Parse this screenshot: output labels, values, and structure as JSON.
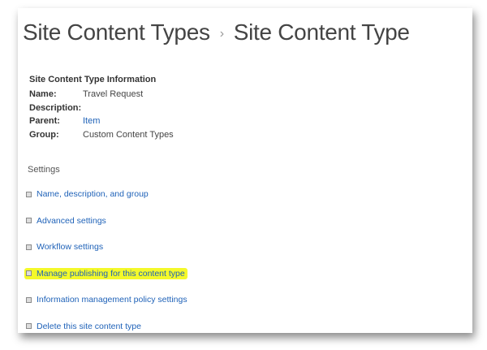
{
  "breadcrumb": {
    "parent": "Site Content Types",
    "separator": "›",
    "current": "Site Content Type"
  },
  "info": {
    "heading": "Site Content Type Information",
    "fields": [
      {
        "label": "Name:",
        "value": "Travel Request",
        "link": false
      },
      {
        "label": "Description:",
        "value": "",
        "link": false
      },
      {
        "label": "Parent:",
        "value": "Item",
        "link": true
      },
      {
        "label": "Group:",
        "value": "Custom Content Types",
        "link": false
      }
    ]
  },
  "settings": {
    "heading": "Settings",
    "items": [
      {
        "label": "Name, description, and group",
        "highlighted": false
      },
      {
        "label": "Advanced settings",
        "highlighted": false
      },
      {
        "label": "Workflow settings",
        "highlighted": false
      },
      {
        "label": "Manage publishing for this content type",
        "highlighted": true
      },
      {
        "label": "Information management policy settings",
        "highlighted": false
      },
      {
        "label": "Delete this site content type",
        "highlighted": false
      }
    ]
  },
  "colors": {
    "link": "#1f62b8",
    "highlight": "#f4f92a"
  }
}
